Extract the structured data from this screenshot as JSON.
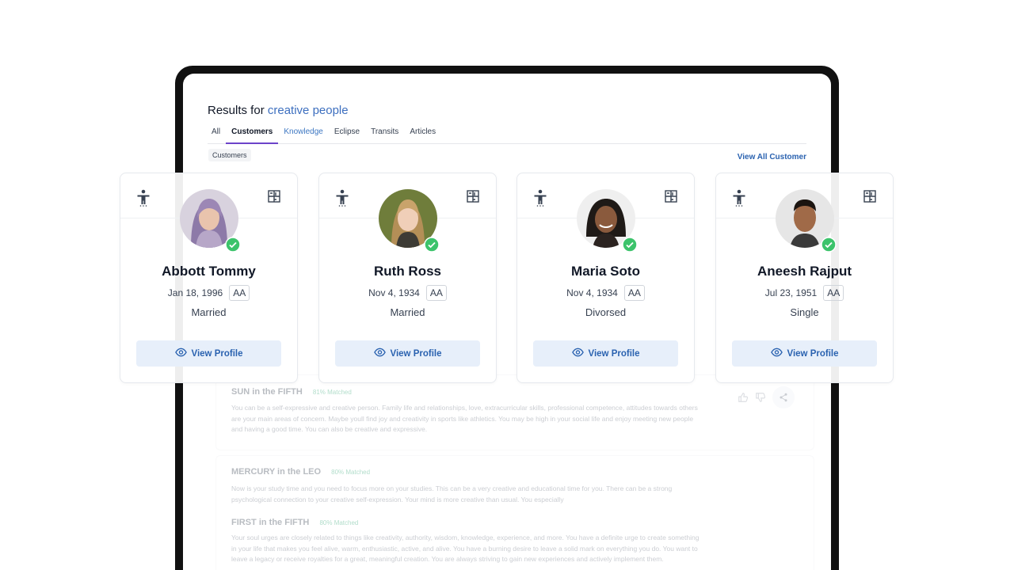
{
  "header": {
    "results_prefix": "Results for",
    "query": "creative people"
  },
  "tabs": [
    {
      "label": "All"
    },
    {
      "label": "Customers"
    },
    {
      "label": "Knowledge"
    },
    {
      "label": "Eclipse"
    },
    {
      "label": "Transits"
    },
    {
      "label": "Articles"
    }
  ],
  "section": {
    "label": "Customers",
    "view_all": "View All Customer"
  },
  "customers": [
    {
      "name": "Abbott Tommy",
      "dob": "Jan 18, 1996",
      "tag": "AA",
      "status": "Married",
      "button": "View Profile"
    },
    {
      "name": "Ruth Ross",
      "dob": "Nov 4, 1934",
      "tag": "AA",
      "status": "Married",
      "button": "View Profile"
    },
    {
      "name": "Maria Soto",
      "dob": "Nov 4, 1934",
      "tag": "AA",
      "status": "Divorsed",
      "button": "View Profile"
    },
    {
      "name": "Aneesh Rajput",
      "dob": "Jul 23, 1951",
      "tag": "AA",
      "status": "Single",
      "button": "View Profile"
    }
  ],
  "knowledge": [
    {
      "title": "SUN in the FIFTH",
      "match": "81% Matched",
      "body": "You can be a self-expressive and creative person. Family life and relationships, love, extracurricular skills, professional competence, attitudes towards others are your main areas of concern. Maybe youll find joy and creativity in sports like athletics. You may be high in your social life and enjoy meeting new people and having a good time. You can also be creative and expressive."
    },
    {
      "title": "MERCURY in the LEO",
      "match": "80% Matched",
      "body": "Now is your study time and you need to focus more on your studies. This can be a very creative and educational time for you. There can be a strong psychological connection to your creative self-expression. Your mind is more creative than usual. You especially"
    },
    {
      "title": "FIRST in the FIFTH",
      "match": "80% Matched",
      "body": "Your soul urges are closely related to things like creativity, authority, wisdom, knowledge, experience, and more. You have a definite urge to create something in your life that makes you feel alive, warm, enthusiastic, active, and alive. You have a burning desire to leave a solid mark on everything you do. You want to leave a legacy or receive royalties for a great, meaningful creation. You are always striving to gain new experiences and actively implement them."
    }
  ],
  "colors": {
    "accent_link": "#3d6fbf",
    "tab_underline": "#6c43c9",
    "button_bg": "#e7effa",
    "verified": "#3cc36b"
  }
}
